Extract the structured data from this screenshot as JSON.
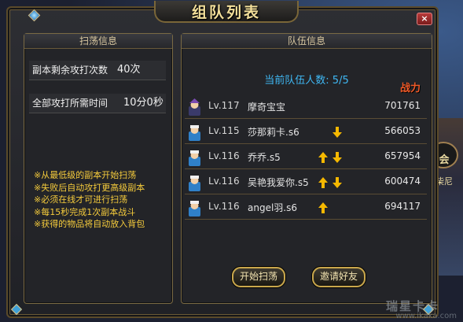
{
  "window": {
    "title": "组队列表",
    "close_label": "×"
  },
  "left_panel": {
    "header": "扫荡信息",
    "rows": [
      {
        "label": "副本剩余攻打次数",
        "value": "40次"
      },
      {
        "label": "全部攻打所需时间",
        "value": "10分0秒"
      }
    ],
    "tips": [
      "※从最低级的副本开始扫荡",
      "※失败后自动攻打更高级副本",
      "※必须在线才可进行扫荡",
      "※每15秒完成1次副本战斗",
      "※获得的物品将自动放入背包"
    ]
  },
  "right_panel": {
    "header": "队伍信息",
    "member_count": "当前队伍人数: 5/5",
    "power_header": "战力",
    "members": [
      {
        "level": "Lv.117",
        "name": "摩奇宝宝",
        "power": "701761",
        "up": false,
        "down": false
      },
      {
        "level": "Lv.115",
        "name": "莎那莉卡.s6",
        "power": "566053",
        "up": false,
        "down": true
      },
      {
        "level": "Lv.116",
        "name": "乔乔.s5",
        "power": "657954",
        "up": true,
        "down": true
      },
      {
        "level": "Lv.116",
        "name": "吴艳我爱你.s5",
        "power": "600474",
        "up": true,
        "down": true
      },
      {
        "level": "Lv.116",
        "name": "angel羽.s6",
        "power": "694117",
        "up": true,
        "down": false
      }
    ],
    "buttons": {
      "start": "开始扫荡",
      "invite": "邀请好友"
    }
  },
  "background": {
    "side_text_1": "会",
    "side_text_2": "柴尼",
    "watermark": "www.ikaka.com",
    "watermark_big": "瑞星卡卡"
  },
  "colors": {
    "accent_gold": "#f3df9a",
    "count_blue": "#3fb8f4",
    "power_red": "#f05a28",
    "tip_yellow": "#f6cc3c"
  }
}
